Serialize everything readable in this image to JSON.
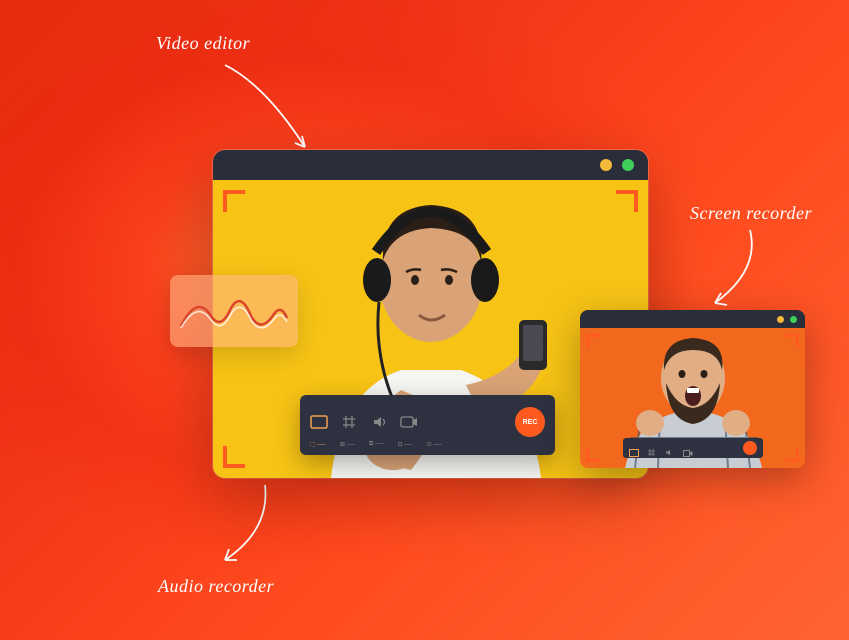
{
  "labels": {
    "video_editor": "Video editor",
    "screen_recorder": "Screen recorder",
    "audio_recorder": "Audio recorder"
  },
  "toolbar": {
    "rec_label": "REC"
  },
  "colors": {
    "accent": "#ff5a1e",
    "window_bg": "#2a2e3a",
    "main_canvas": "#f7c315",
    "small_canvas": "#f2681c"
  }
}
